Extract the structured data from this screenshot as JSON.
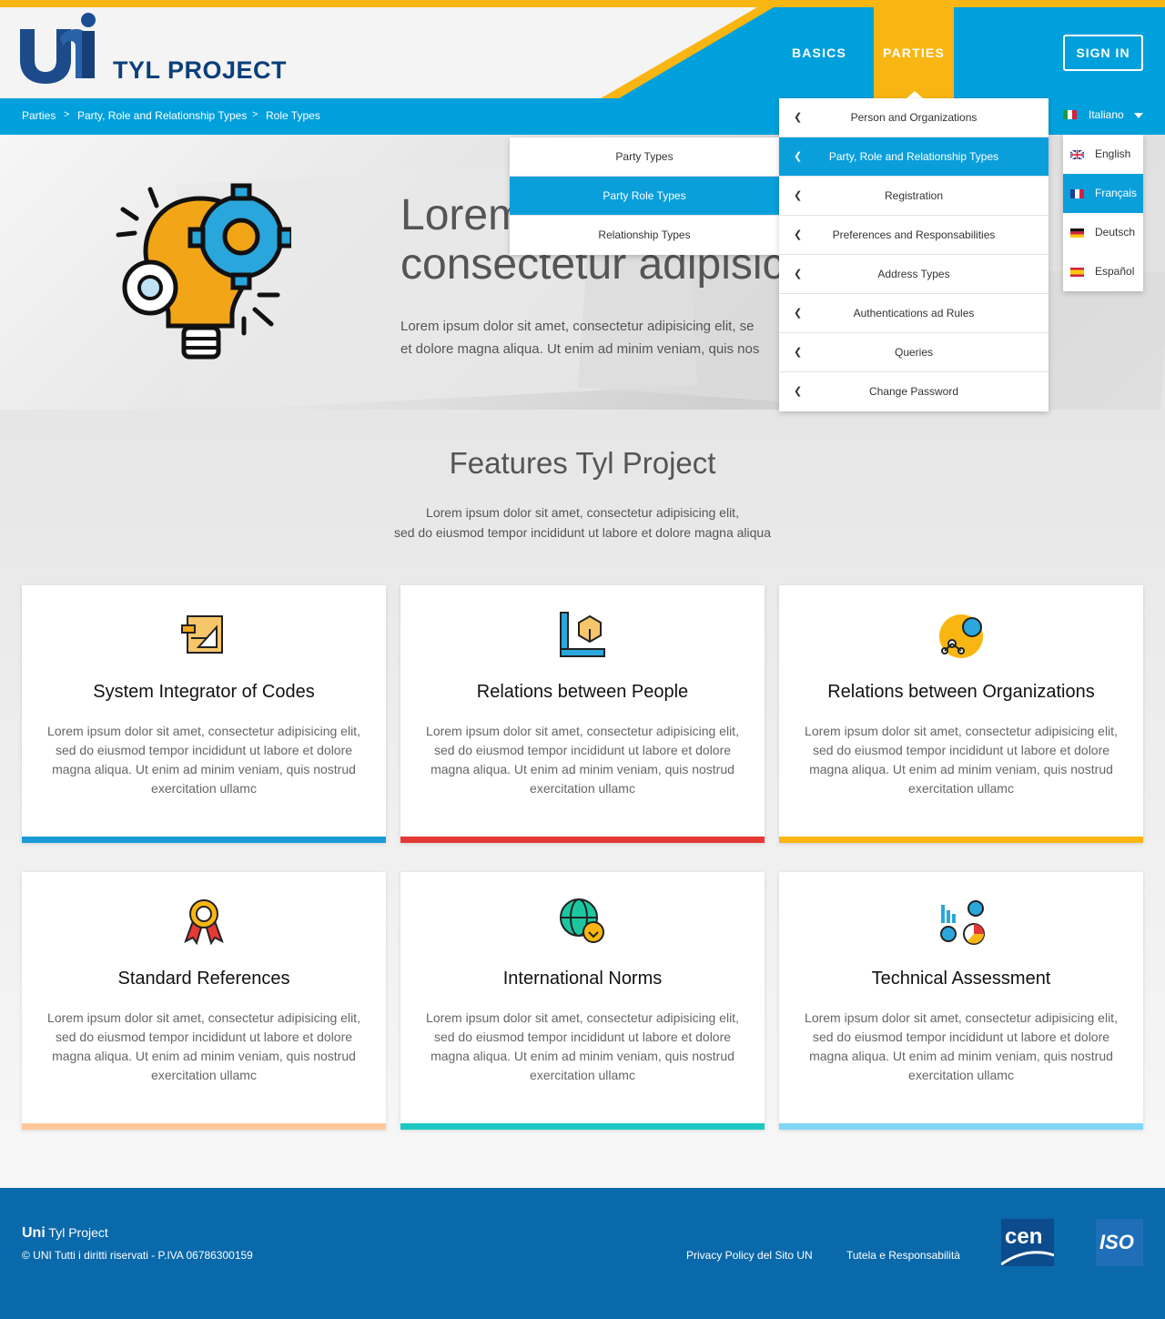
{
  "header": {
    "brand": "TYL PROJECT",
    "nav": {
      "basics": "BASICS",
      "parties": "PARTIES"
    },
    "signin": "SIGN IN"
  },
  "breadcrumb": [
    "Parties",
    "Party, Role and Relationship Types",
    "Role Types"
  ],
  "breadcrumb_sep": ">",
  "language": {
    "current": "Italiano",
    "options": [
      "English",
      "Français",
      "Deutsch",
      "Español"
    ]
  },
  "parties_menu": [
    "Person and Organizations",
    "Party, Role and Relationship Types",
    "Registration",
    "Preferences and Responsabilities",
    "Address Types",
    "Authentications ad Rules",
    "Queries",
    "Change Password"
  ],
  "submenu": [
    "Party Types",
    "Party Role Types",
    "Relationship Types"
  ],
  "hero": {
    "title_line1": "Lorem",
    "title_line2": "consectetur adipisic",
    "text_line1": "Lorem ipsum dolor sit amet, consectetur adipisicing elit, se",
    "text_line2": "et dolore magna aliqua. Ut enim ad minim veniam, quis nos"
  },
  "features": {
    "title": "Features Tyl Project",
    "subtitle_line1": "Lorem ipsum dolor sit amet, consectetur adipisicing elit,",
    "subtitle_line2": "sed do eiusmod tempor incididunt ut labore et dolore magna aliqua",
    "cards": [
      {
        "title": "System Integrator of Codes",
        "text": "Lorem ipsum dolor sit amet, consectetur adipisicing elit, sed do eiusmod tempor incididunt ut labore et dolore magna aliqua. Ut enim ad minim veniam, quis nostrud exercitation ullamc",
        "accent": "#1a9bd7",
        "icon": "blueprint-icon"
      },
      {
        "title": "Relations between People",
        "text": "Lorem ipsum dolor sit amet, consectetur adipisicing elit, sed do eiusmod tempor incididunt ut labore et dolore magna aliqua. Ut enim ad minim veniam, quis nostrud exercitation ullamc",
        "accent": "#e53935",
        "icon": "measure-box-icon"
      },
      {
        "title": "Relations between Organizations",
        "text": "Lorem ipsum dolor sit amet, consectetur adipisicing elit, sed do eiusmod tempor incididunt ut labore et dolore magna aliqua. Ut enim ad minim veniam, quis nostrud exercitation ullamc",
        "accent": "#f9b612",
        "icon": "network-idea-icon"
      },
      {
        "title": "Standard References",
        "text": "Lorem ipsum dolor sit amet, consectetur adipisicing elit, sed do eiusmod tempor incididunt ut labore et dolore magna aliqua. Ut enim ad minim veniam, quis nostrud exercitation ullamc",
        "accent": "#ffc89a",
        "icon": "award-ribbon-icon"
      },
      {
        "title": "International Norms",
        "text": "Lorem ipsum dolor sit amet, consectetur adipisicing elit, sed do eiusmod tempor incididunt ut labore et dolore magna aliqua. Ut enim ad minim veniam, quis nostrud exercitation ullamc",
        "accent": "#1cc6c2",
        "icon": "globe-download-icon"
      },
      {
        "title": "Technical Assessment",
        "text": "Lorem ipsum dolor sit amet, consectetur adipisicing elit, sed do eiusmod tempor incididunt ut labore et dolore magna aliqua. Ut enim ad minim veniam, quis nostrud exercitation ullamc",
        "accent": "#7fd6f7",
        "icon": "analytics-gears-icon"
      }
    ]
  },
  "footer": {
    "brand_bold": "Uni",
    "brand_rest": " Tyl Project",
    "copyright": "© UNI Tutti i diritti riservati - P.IVA 06786300159",
    "privacy": "Privacy Policy del Sito UN",
    "tutela": "Tutela e Responsabilità",
    "cen": "cen",
    "iso": "ISO"
  }
}
